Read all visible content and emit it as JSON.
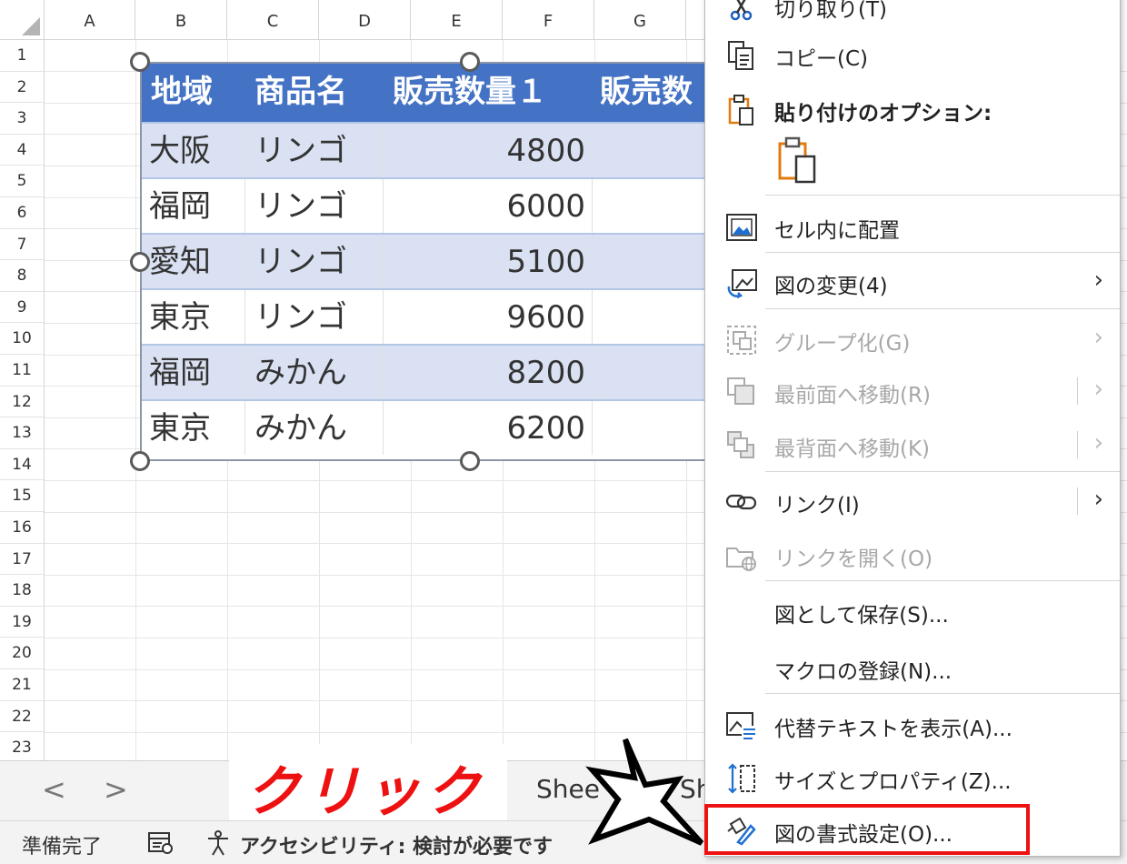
{
  "sheet": {
    "columns": [
      "A",
      "B",
      "C",
      "D",
      "E",
      "F",
      "G"
    ],
    "rows": [
      "1",
      "2",
      "3",
      "4",
      "5",
      "6",
      "7",
      "8",
      "9",
      "10",
      "11",
      "12",
      "13",
      "14",
      "15",
      "16",
      "17",
      "18",
      "19",
      "20",
      "21",
      "22",
      "23"
    ]
  },
  "picture": {
    "headers": [
      "地域",
      "商品名",
      "販売数量１",
      "販売数"
    ],
    "rows": [
      [
        "大阪",
        "リンゴ",
        "4800"
      ],
      [
        "福岡",
        "リンゴ",
        "6000"
      ],
      [
        "愛知",
        "リンゴ",
        "5100"
      ],
      [
        "東京",
        "リンゴ",
        "9600"
      ],
      [
        "福岡",
        "みかん",
        "8200"
      ],
      [
        "東京",
        "みかん",
        "6200"
      ]
    ],
    "header_color": "#4472c4",
    "band_color": "#d9e1f2"
  },
  "tabbar": {
    "prev": "<",
    "next": ">",
    "tab1": "Shee",
    "tab2": "Sh"
  },
  "annotation": {
    "click_text": "クリック",
    "color": "#ee1111"
  },
  "status": {
    "ready": "準備完了",
    "accessibility": "アクセシビリティ: 検討が必要です"
  },
  "menu": {
    "items": [
      {
        "label": "切り取り(T)",
        "icon": "scissors-icon",
        "enabled": true
      },
      {
        "label": "コピー(C)",
        "icon": "copy-icon",
        "enabled": true
      },
      {
        "label": "貼り付けのオプション:",
        "icon": "clipboard-icon",
        "enabled": true
      },
      {
        "label": "セル内に配置",
        "icon": "place-in-cell-icon",
        "enabled": true
      },
      {
        "label": "図の変更(4)",
        "icon": "change-picture-icon",
        "enabled": true,
        "submenu": true
      },
      {
        "label": "グループ化(G)",
        "icon": "group-icon",
        "enabled": false,
        "submenu": true
      },
      {
        "label": "最前面へ移動(R)",
        "icon": "bring-to-front-icon",
        "enabled": false,
        "submenu": true
      },
      {
        "label": "最背面へ移動(K)",
        "icon": "send-to-back-icon",
        "enabled": false,
        "submenu": true
      },
      {
        "label": "リンク(I)",
        "icon": "link-icon",
        "enabled": true,
        "submenu": true
      },
      {
        "label": "リンクを開く(O)",
        "icon": "open-link-icon",
        "enabled": false
      },
      {
        "label": "図として保存(S)...",
        "icon": "",
        "enabled": true
      },
      {
        "label": "マクロの登録(N)...",
        "icon": "",
        "enabled": true
      },
      {
        "label": "代替テキストを表示(A)...",
        "icon": "alt-text-icon",
        "enabled": true
      },
      {
        "label": "サイズとプロパティ(Z)...",
        "icon": "size-properties-icon",
        "enabled": true
      },
      {
        "label": "図の書式設定(O)...",
        "icon": "format-picture-icon",
        "enabled": true,
        "highlighted": true
      }
    ],
    "submenu_arrow": "›"
  }
}
